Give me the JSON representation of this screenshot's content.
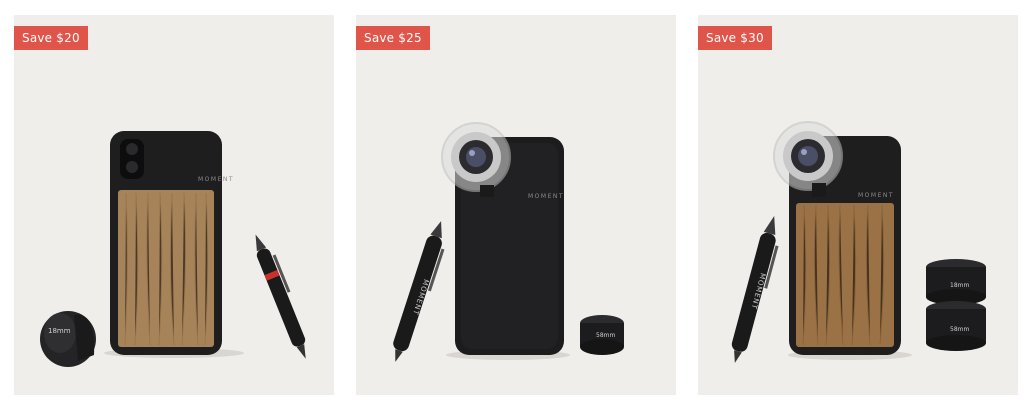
{
  "badge_color": "#e0554a",
  "products": [
    {
      "badge": "Save $20",
      "phone_logo": "MOMENT",
      "pen_logo": "",
      "lens_mark": "18mm"
    },
    {
      "badge": "Save $25",
      "phone_logo": "MOMENT",
      "pen_logo": "MOMENT",
      "lens_mark": "58mm"
    },
    {
      "badge": "Save $30",
      "phone_logo": "MOMENT",
      "pen_logo": "MOMENT",
      "lens_mark_top": "18mm",
      "lens_mark_bottom": "58mm"
    }
  ]
}
